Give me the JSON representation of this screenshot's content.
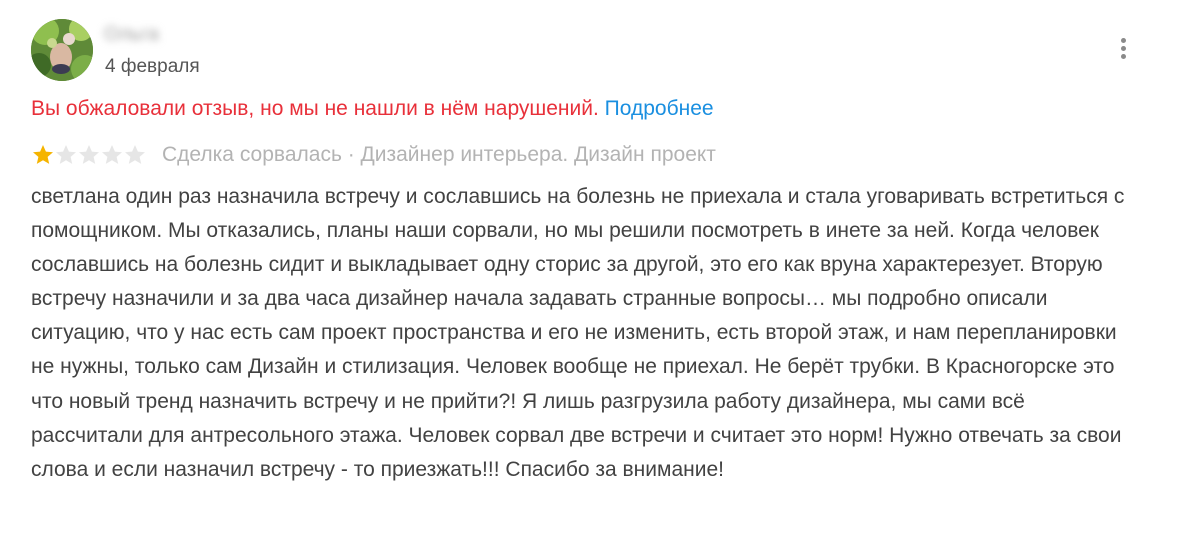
{
  "review": {
    "author_name": "Ольга",
    "date": "4 февраля",
    "warning": {
      "text": "Вы обжаловали отзыв, но мы не нашли в нём нарушений.",
      "link": "Подробнее",
      "text_color": "#e8303a",
      "link_color": "#1a8fe0"
    },
    "rating": {
      "value": 1,
      "max": 5,
      "filled_color": "#f5b400",
      "empty_color": "#e6e6e6"
    },
    "meta": "Сделка сорвалась · Дизайнер интерьера. Дизайн проект",
    "body": "светлана один раз назначила встречу и сославшись на болезнь не приехала и стала уговаривать встретиться с помощником. Мы отказались, планы наши сорвали, но мы решили посмотреть в инете за ней. Когда человек сославшись на болезнь сидит и выкладывает одну сторис за другой, это его как вруна характерезует. Вторую встречу назначили и за два часа дизайнер начала задавать странные вопросы… мы подробно описали ситуацию, что у нас есть сам проект пространства и его не изменить, есть второй этаж, и нам перепланировки не нужны, только сам Дизайн и стилизация. Человек вообще не приехал. Не берёт трубки. В Красногорске это что новый тренд назначить встречу и не прийти?! Я лишь разгрузила работу дизайнера, мы сами всё рассчитали для антресольного этажа. Человек сорвал две встречи и считает это норм! Нужно отвечать за свои слова и если назначил встречу - то приезжать!!! Спасибо за внимание!",
    "icons": {
      "menu": "more-vertical-icon",
      "star": "star-icon"
    }
  }
}
